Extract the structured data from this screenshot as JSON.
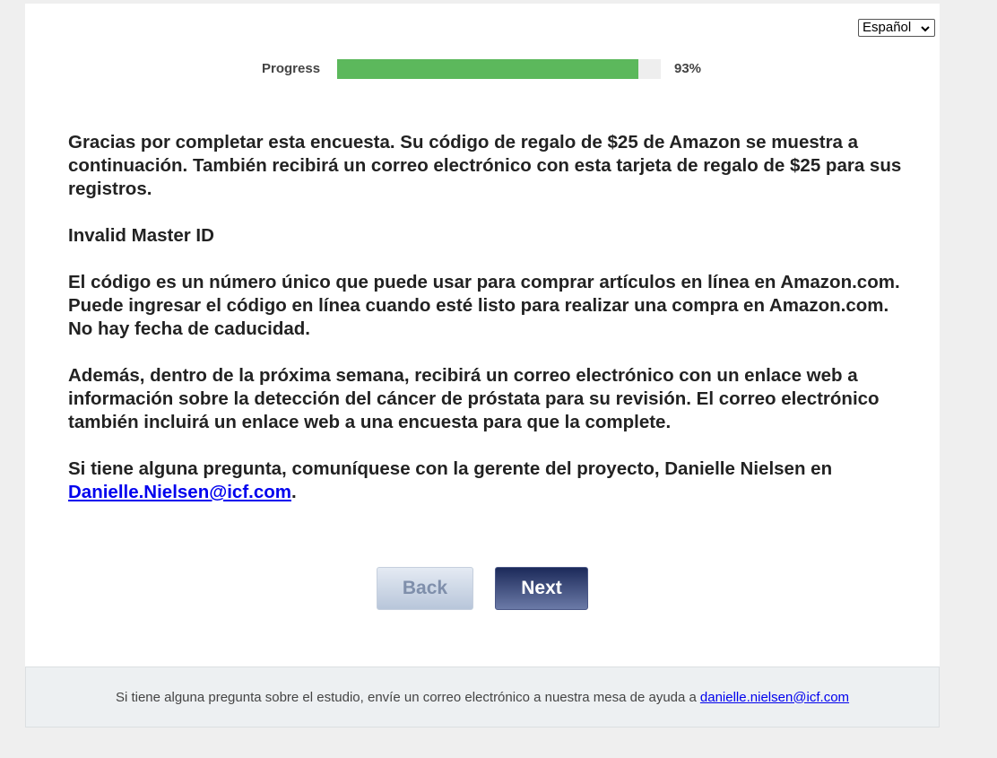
{
  "language_select": {
    "selected": "Español",
    "icon": "chevron-down-icon"
  },
  "progress": {
    "label": "Progress",
    "value_text": "93%",
    "fraction": 0.93,
    "color": "#5cb85c"
  },
  "content": {
    "paragraph1": "Gracias por completar esta encuesta. Su código de regalo de $25 de Amazon se muestra a continuación. También recibirá un correo electrónico con esta tarjeta de regalo de $25 para sus registros.",
    "master_id_message": "Invalid Master ID",
    "paragraph2": "El código es un número único que puede usar para comprar artículos en línea en Amazon.com. Puede ingresar el código en línea cuando esté listo para realizar una compra en Amazon.com. No hay fecha de caducidad.",
    "paragraph3": "Además, dentro de la próxima semana, recibirá un correo electrónico con un enlace web a información sobre la detección del cáncer de próstata para su revisión. El correo electrónico también incluirá un enlace web a una encuesta para que la complete.",
    "contact_text": "Si tiene alguna pregunta, comuníquese con la gerente del proyecto, Danielle Nielsen en ",
    "contact_email": "Danielle.Nielsen@icf.com",
    "contact_end": "."
  },
  "buttons": {
    "back_label": "Back",
    "next_label": "Next"
  },
  "footer": {
    "text": "Si tiene alguna pregunta sobre el estudio, envíe un correo electrónico a nuestra mesa de ayuda a",
    "email": "danielle.nielsen@icf.com"
  }
}
